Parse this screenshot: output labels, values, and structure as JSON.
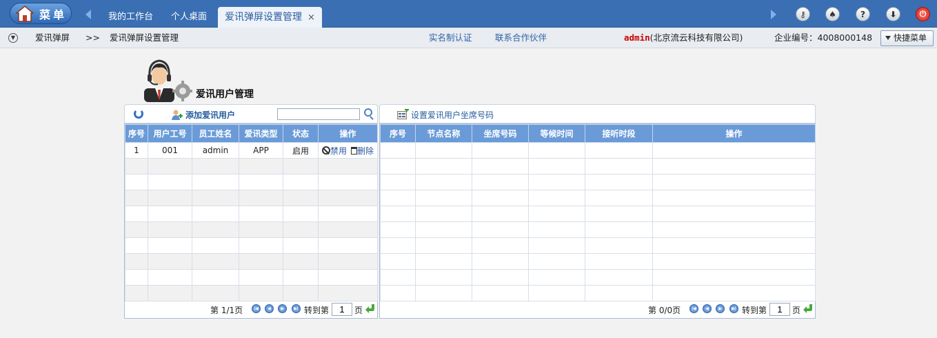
{
  "topbar": {
    "menu_label": "菜单",
    "tabs": [
      {
        "label": "我的工作台"
      },
      {
        "label": "个人桌面"
      },
      {
        "label": "爱讯弹屏设置管理",
        "close": "×"
      }
    ],
    "icons": [
      "key-icon",
      "shirt-icon",
      "help-icon",
      "download-icon",
      "power-icon"
    ],
    "icon_glyphs": {
      "key": "⚷",
      "shirt": "♠",
      "help": "?",
      "download": "⬇",
      "power": "⏻"
    }
  },
  "navbar": {
    "expand_glyph": "▼",
    "breadcrumb": [
      "爱讯弹屏",
      "爱讯弹屏设置管理"
    ],
    "separator": ">>",
    "links": [
      "实名制认证",
      "联系合作伙伴"
    ],
    "user": "admin",
    "company": "(北京流云科技有限公司)",
    "company_id_label": "企业编号：4008000148",
    "quick_menu": "快捷菜单"
  },
  "page": {
    "title": "爱讯用户管理"
  },
  "left_panel": {
    "add_label": "添加爱讯用户",
    "search_value": "",
    "columns": [
      "序号",
      "用户工号",
      "员工姓名",
      "爱讯类型",
      "状态",
      "操作"
    ],
    "rows": [
      {
        "no": "1",
        "id": "001",
        "name": "admin",
        "type": "APP",
        "status": "启用",
        "op_disable": "禁用",
        "op_delete": "删除"
      }
    ],
    "pager": {
      "page_info": "第 1/1页",
      "goto_label": "转到第",
      "page_value": "1",
      "page_suffix": "页"
    }
  },
  "right_panel": {
    "set_label": "设置爱讯用户坐席号码",
    "columns": [
      "序号",
      "节点名称",
      "坐席号码",
      "等候时间",
      "接听时段",
      "操作"
    ],
    "rows": [],
    "pager": {
      "page_info": "第 0/0页",
      "goto_label": "转到第",
      "page_value": "1",
      "page_suffix": "页"
    }
  },
  "colors": {
    "topbar": "#3a6fb3",
    "table_header": "#6a9bd8",
    "link": "#245c9e",
    "admin": "#cc0000"
  }
}
